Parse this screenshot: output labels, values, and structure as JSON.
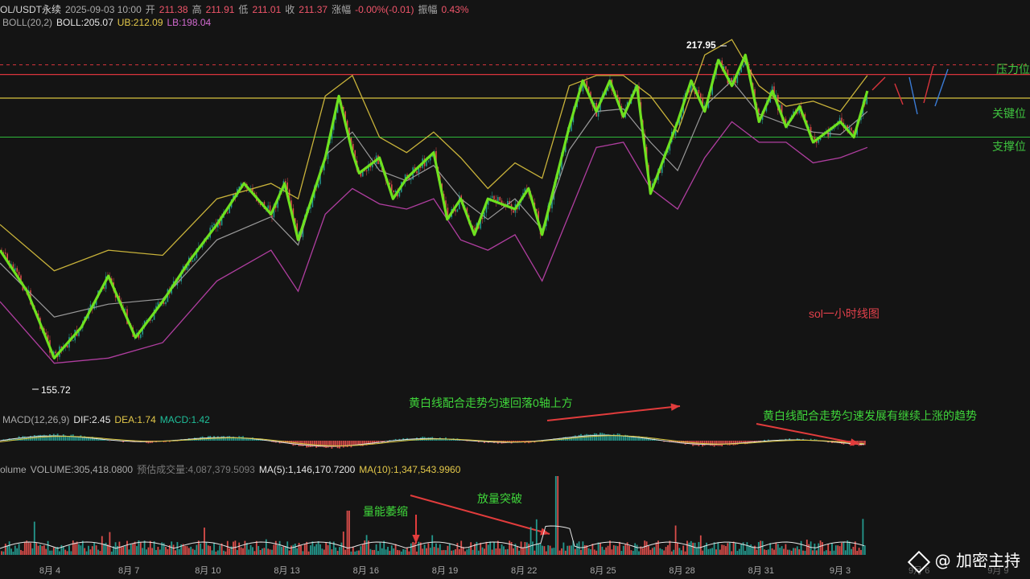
{
  "header": {
    "symbol": "OL/USDT永续",
    "datetime": "2025-09-03 10:00",
    "open_label": "开",
    "open": "211.38",
    "high_label": "高",
    "high": "211.91",
    "low_label": "低",
    "low": "211.01",
    "close_label": "收",
    "close": "211.37",
    "change_label": "涨幅",
    "change": "-0.00%(-0.01)",
    "amp_label": "振幅",
    "amp": "0.43%"
  },
  "boll": {
    "label": "BOLL(20,2)",
    "boll": "BOLL:205.07",
    "ub": "UB:212.09",
    "lb": "LB:198.04"
  },
  "levels": {
    "resistance": "压力位",
    "key": "关键位",
    "support": "支撑位"
  },
  "annotations": {
    "high": "217.95",
    "low": "155.72",
    "chart_note": "sol一小时线图",
    "macd_note1": "黄白线配合走势匀速回落0轴上方",
    "macd_note2": "黄白线配合走势匀速发展有继续上涨的趋势",
    "vol_note1": "量能萎缩",
    "vol_note2": "放量突破"
  },
  "macd": {
    "label": "MACD(12,26,9)",
    "dif": "DIF:2.45",
    "dea": "DEA:1.74",
    "macd": "MACD:1.42"
  },
  "volume": {
    "label": "olume",
    "vol": "VOLUME:305,418.0800",
    "est": "预估成交量:4,087,379.5093",
    "ma5": "MA(5):1,146,170.7200",
    "ma10": "MA(10):1,347,543.9960"
  },
  "watermark": "@ 加密主持",
  "colors": {
    "resistance": "#d9343c",
    "key": "#d6c23d",
    "support": "#2fb83a",
    "zigzag": "#6ee11f",
    "ub": "#c9b33a",
    "lb": "#b03ea0",
    "mid": "#9a9a9a",
    "up": "#26a69a",
    "down": "#ef5350"
  },
  "chart_data": {
    "type": "line",
    "title": "sol一小时线图",
    "x_ticks": [
      "8月 4",
      "8月 7",
      "8月 10",
      "8月 13",
      "8月 16",
      "8月 19",
      "8月 22",
      "8月 25",
      "8月 28",
      "8月 31",
      "9月 3",
      "9月 6",
      "9月 9"
    ],
    "xlim": [
      "2025-08-02",
      "2025-09-09"
    ],
    "ylim": [
      150,
      222
    ],
    "levels": {
      "resistance": 212.2,
      "key": 207.6,
      "support": 200.0
    },
    "series": [
      {
        "role": "zigzag",
        "points": [
          [
            "2025-08-02",
            178
          ],
          [
            "2025-08-03",
            170
          ],
          [
            "2025-08-04",
            157
          ],
          [
            "2025-08-05",
            163
          ],
          [
            "2025-08-06",
            173
          ],
          [
            "2025-08-07",
            161
          ],
          [
            "2025-08-08",
            168
          ],
          [
            "2025-08-09",
            176
          ],
          [
            "2025-08-10",
            183
          ],
          [
            "2025-08-11",
            191
          ],
          [
            "2025-08-12",
            185
          ],
          [
            "2025-08-12 12:00",
            191
          ],
          [
            "2025-08-13",
            180
          ],
          [
            "2025-08-14",
            196
          ],
          [
            "2025-08-14 12:00",
            208
          ],
          [
            "2025-08-15",
            197
          ],
          [
            "2025-08-15 06:00",
            193
          ],
          [
            "2025-08-16",
            196
          ],
          [
            "2025-08-16 12:00",
            188
          ],
          [
            "2025-08-17",
            192
          ],
          [
            "2025-08-18",
            197
          ],
          [
            "2025-08-18 12:00",
            184
          ],
          [
            "2025-08-19",
            188
          ],
          [
            "2025-08-19 12:00",
            181
          ],
          [
            "2025-08-20",
            188
          ],
          [
            "2025-08-21",
            186
          ],
          [
            "2025-08-21 12:00",
            190
          ],
          [
            "2025-08-22",
            181
          ],
          [
            "2025-08-23",
            202
          ],
          [
            "2025-08-23 12:00",
            211
          ],
          [
            "2025-08-24",
            205
          ],
          [
            "2025-08-24 12:00",
            211
          ],
          [
            "2025-08-25",
            204
          ],
          [
            "2025-08-25 12:00",
            210
          ],
          [
            "2025-08-26",
            189
          ],
          [
            "2025-08-27",
            203
          ],
          [
            "2025-08-27 12:00",
            211
          ],
          [
            "2025-08-28",
            205
          ],
          [
            "2025-08-28 12:00",
            215
          ],
          [
            "2025-08-29",
            210
          ],
          [
            "2025-08-29 12:00",
            216
          ],
          [
            "2025-08-30",
            203
          ],
          [
            "2025-08-30 12:00",
            209
          ],
          [
            "2025-08-31",
            202
          ],
          [
            "2025-08-31 12:00",
            206
          ],
          [
            "2025-09-01",
            199
          ],
          [
            "2025-09-02",
            203
          ],
          [
            "2025-09-02 12:00",
            200
          ],
          [
            "2025-09-03",
            209
          ]
        ]
      },
      {
        "name": "UB",
        "values_note": "BOLL upper band",
        "points": [
          [
            "2025-08-02",
            183
          ],
          [
            "2025-08-04",
            174
          ],
          [
            "2025-08-06",
            178
          ],
          [
            "2025-08-08",
            177
          ],
          [
            "2025-08-10",
            188
          ],
          [
            "2025-08-12",
            191
          ],
          [
            "2025-08-13",
            188
          ],
          [
            "2025-08-14",
            208
          ],
          [
            "2025-08-15",
            212
          ],
          [
            "2025-08-16",
            200
          ],
          [
            "2025-08-17",
            197
          ],
          [
            "2025-08-18",
            201
          ],
          [
            "2025-08-19",
            196
          ],
          [
            "2025-08-20",
            190
          ],
          [
            "2025-08-21",
            195
          ],
          [
            "2025-08-22",
            192
          ],
          [
            "2025-08-23",
            210
          ],
          [
            "2025-08-24",
            212
          ],
          [
            "2025-08-25",
            212
          ],
          [
            "2025-08-26",
            208
          ],
          [
            "2025-08-27",
            201
          ],
          [
            "2025-08-28",
            216
          ],
          [
            "2025-08-29",
            219
          ],
          [
            "2025-08-30",
            210
          ],
          [
            "2025-08-31",
            206
          ],
          [
            "2025-09-01",
            207
          ],
          [
            "2025-09-02",
            205
          ],
          [
            "2025-09-03",
            212
          ]
        ]
      },
      {
        "name": "LB",
        "points": [
          [
            "2025-08-02",
            168
          ],
          [
            "2025-08-04",
            156
          ],
          [
            "2025-08-06",
            157
          ],
          [
            "2025-08-08",
            160
          ],
          [
            "2025-08-10",
            172
          ],
          [
            "2025-08-12",
            178
          ],
          [
            "2025-08-13",
            170
          ],
          [
            "2025-08-14",
            185
          ],
          [
            "2025-08-15",
            190
          ],
          [
            "2025-08-16",
            187
          ],
          [
            "2025-08-17",
            186
          ],
          [
            "2025-08-18",
            188
          ],
          [
            "2025-08-19",
            180
          ],
          [
            "2025-08-20",
            178
          ],
          [
            "2025-08-21",
            181
          ],
          [
            "2025-08-22",
            172
          ],
          [
            "2025-08-23",
            185
          ],
          [
            "2025-08-24",
            198
          ],
          [
            "2025-08-25",
            199
          ],
          [
            "2025-08-26",
            190
          ],
          [
            "2025-08-27",
            186
          ],
          [
            "2025-08-28",
            196
          ],
          [
            "2025-08-29",
            203
          ],
          [
            "2025-08-30",
            199
          ],
          [
            "2025-08-31",
            199
          ],
          [
            "2025-09-01",
            195
          ],
          [
            "2025-09-02",
            196
          ],
          [
            "2025-09-03",
            198
          ]
        ]
      }
    ]
  }
}
